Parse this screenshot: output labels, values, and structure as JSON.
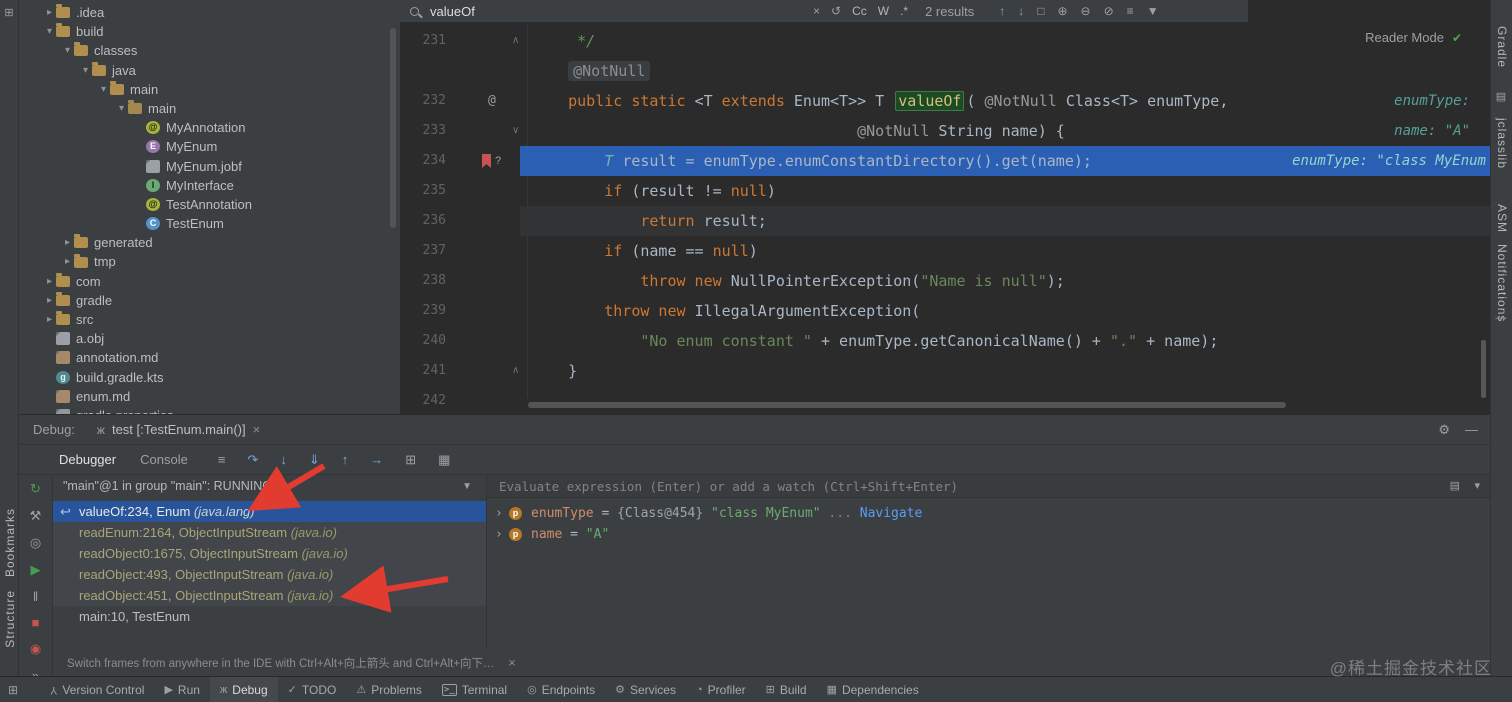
{
  "glyphs": {
    "tool_windows": "⊞",
    "gear": "⚙",
    "minimize": "—",
    "close": "×",
    "bug": "ж",
    "reader_check": "✔",
    "funnel": "▼",
    "db": "▤",
    "dash": "—",
    "return_arrow": "↩"
  },
  "find_bar": {
    "query": "valueOf",
    "match_case": "Cc",
    "words": "W",
    "regex": ".*",
    "results": "2 results",
    "left_icons": [
      {
        "name": "clear-search-icon",
        "glyph": "×"
      },
      {
        "name": "search-history-icon",
        "glyph": "↺"
      }
    ],
    "right_icons": [
      {
        "name": "prev-occurrence-icon",
        "glyph": "↑",
        "cls": "blue"
      },
      {
        "name": "next-occurrence-icon",
        "glyph": "↓",
        "cls": "blue"
      },
      {
        "name": "select-all-occurrences-icon",
        "glyph": "□"
      },
      {
        "name": "add-selection-icon",
        "glyph": "⊕"
      },
      {
        "name": "remove-selection-icon",
        "glyph": "⊖"
      },
      {
        "name": "exclude-selection-icon",
        "glyph": "⊘"
      },
      {
        "name": "filter-search-lines-icon",
        "glyph": "≡"
      },
      {
        "name": "search-filter-funnel-icon",
        "glyph": "▼"
      }
    ]
  },
  "project_tree": {
    "items": [
      {
        "label": ".idea",
        "depth": 1,
        "chevron": "right",
        "icon": "folder"
      },
      {
        "label": "build",
        "depth": 1,
        "chevron": "down",
        "icon": "folder"
      },
      {
        "label": "classes",
        "depth": 2,
        "chevron": "down",
        "icon": "folder"
      },
      {
        "label": "java",
        "depth": 3,
        "chevron": "down",
        "icon": "folder"
      },
      {
        "label": "main",
        "depth": 4,
        "chevron": "down",
        "icon": "folder"
      },
      {
        "label": "main",
        "depth": 5,
        "chevron": "down",
        "icon": "package"
      },
      {
        "label": "MyAnnotation",
        "depth": 6,
        "chevron": "none",
        "icon": "annotation"
      },
      {
        "label": "MyEnum",
        "depth": 6,
        "chevron": "none",
        "icon": "enum"
      },
      {
        "label": "MyEnum.jobf",
        "depth": 6,
        "chevron": "none",
        "icon": "file"
      },
      {
        "label": "MyInterface",
        "depth": 6,
        "chevron": "none",
        "icon": "interface"
      },
      {
        "label": "TestAnnotation",
        "depth": 6,
        "chevron": "none",
        "icon": "annotation"
      },
      {
        "label": "TestEnum",
        "depth": 6,
        "chevron": "none",
        "icon": "class"
      },
      {
        "label": "generated",
        "depth": 2,
        "chevron": "right",
        "icon": "folder"
      },
      {
        "label": "tmp",
        "depth": 2,
        "chevron": "right",
        "icon": "folder"
      },
      {
        "label": "com",
        "depth": 1,
        "chevron": "right",
        "icon": "folder"
      },
      {
        "label": "gradle",
        "depth": 1,
        "chevron": "right",
        "icon": "folder"
      },
      {
        "label": "src",
        "depth": 1,
        "chevron": "right",
        "icon": "folder"
      },
      {
        "label": "a.obj",
        "depth": 1,
        "chevron": "none",
        "icon": "file"
      },
      {
        "label": "annotation.md",
        "depth": 1,
        "chevron": "none",
        "icon": "markdown"
      },
      {
        "label": "build.gradle.kts",
        "depth": 1,
        "chevron": "none",
        "icon": "gradle"
      },
      {
        "label": "enum.md",
        "depth": 1,
        "chevron": "none",
        "icon": "markdown"
      },
      {
        "label": "gradle.properties",
        "depth": 1,
        "chevron": "none",
        "icon": "properties"
      }
    ]
  },
  "editor": {
    "reader_mode": "Reader Mode",
    "lines": [
      {
        "num": "231",
        "fold": "up",
        "tokens": [
          {
            "t": "     */",
            "c": "cm"
          }
        ]
      },
      {
        "num": "",
        "ann": true,
        "tokens": [
          {
            "t": "    ",
            "c": "d"
          },
          {
            "t": "@NotNull",
            "c": "chip"
          }
        ]
      },
      {
        "num": "232",
        "gutter_at": true,
        "tokens": [
          {
            "t": "    ",
            "c": "d"
          },
          {
            "t": "public static ",
            "c": "k"
          },
          {
            "t": "<T ",
            "c": "d"
          },
          {
            "t": "extends ",
            "c": "k"
          },
          {
            "t": "Enum<T>> T ",
            "c": "d"
          },
          {
            "t": "valueOf",
            "c": "match"
          },
          {
            "t": "( ",
            "c": "d"
          },
          {
            "t": "@NotNull ",
            "c": "ext"
          },
          {
            "t": "Class<T> enumType,",
            "c": "d"
          }
        ],
        "hint": "enumType:"
      },
      {
        "num": "233",
        "fold": "down",
        "tokens": [
          {
            "t": "                                    ",
            "c": "d"
          },
          {
            "t": "@NotNull ",
            "c": "ext"
          },
          {
            "t": "String name) {",
            "c": "d"
          }
        ],
        "hint": "name: \"A\""
      },
      {
        "num": "234",
        "exec": true,
        "tokens": [
          {
            "t": "        ",
            "c": "d"
          },
          {
            "t": "T ",
            "c": "tp"
          },
          {
            "t": "result = enumType.enumConstantDirectory().get(name);",
            "c": "d"
          }
        ],
        "hint": "enumType: \"class MyEnum"
      },
      {
        "num": "235",
        "tokens": [
          {
            "t": "        ",
            "c": "d"
          },
          {
            "t": "if ",
            "c": "k"
          },
          {
            "t": "(result != ",
            "c": "d"
          },
          {
            "t": "null",
            "c": "k"
          },
          {
            "t": ")",
            "c": "d"
          }
        ]
      },
      {
        "num": "236",
        "caret": true,
        "tokens": [
          {
            "t": "            ",
            "c": "d"
          },
          {
            "t": "return ",
            "c": "k"
          },
          {
            "t": "result;",
            "c": "d"
          }
        ]
      },
      {
        "num": "237",
        "tokens": [
          {
            "t": "        ",
            "c": "d"
          },
          {
            "t": "if ",
            "c": "k"
          },
          {
            "t": "(name == ",
            "c": "d"
          },
          {
            "t": "null",
            "c": "k"
          },
          {
            "t": ")",
            "c": "d"
          }
        ]
      },
      {
        "num": "238",
        "tokens": [
          {
            "t": "            ",
            "c": "d"
          },
          {
            "t": "throw new ",
            "c": "k"
          },
          {
            "t": "NullPointerException(",
            "c": "d"
          },
          {
            "t": "\"Name is null\"",
            "c": "s"
          },
          {
            "t": ");",
            "c": "d"
          }
        ]
      },
      {
        "num": "239",
        "tokens": [
          {
            "t": "        ",
            "c": "d"
          },
          {
            "t": "throw new ",
            "c": "k"
          },
          {
            "t": "IllegalArgumentException(",
            "c": "d"
          }
        ]
      },
      {
        "num": "240",
        "tokens": [
          {
            "t": "            ",
            "c": "d"
          },
          {
            "t": "\"No enum constant \"",
            "c": "s"
          },
          {
            "t": " + enumType.getCanonicalName() + ",
            "c": "d"
          },
          {
            "t": "\".\"",
            "c": "s"
          },
          {
            "t": " + name);",
            "c": "d"
          }
        ]
      },
      {
        "num": "241",
        "fold": "up",
        "tokens": [
          {
            "t": "    }",
            "c": "d"
          }
        ]
      },
      {
        "num": "242",
        "tokens": []
      }
    ]
  },
  "debug": {
    "label": "Debug:",
    "session_tab": "test [:TestEnum.main()]",
    "tabs": [
      "Debugger",
      "Console"
    ],
    "toolbar_icons": [
      {
        "name": "show-execution-point-icon",
        "glyph": "≡"
      },
      {
        "name": "step-over-icon",
        "glyph": "↷",
        "cls": "blue"
      },
      {
        "name": "step-into-icon",
        "glyph": "↓",
        "cls": "blue"
      },
      {
        "name": "force-step-into-icon",
        "glyph": "⇓",
        "cls": "blue"
      },
      {
        "name": "step-out-icon",
        "glyph": "↑",
        "cls": "blue"
      },
      {
        "name": "run-to-cursor-icon",
        "glyph": "→",
        "cls": "blue"
      },
      {
        "name": "view-layout-grid-icon",
        "glyph": "⊞"
      },
      {
        "name": "restore-layout-icon",
        "glyph": "▦"
      }
    ],
    "left_toolbar": [
      {
        "name": "rerun-debug-icon",
        "glyph": "↻",
        "cls": "green"
      },
      {
        "name": "build-hammer-icon",
        "glyph": "⚒"
      },
      {
        "name": "view-breakpoints-icon",
        "glyph": "◎"
      },
      {
        "name": "resume-icon",
        "glyph": "▶",
        "cls": "green"
      },
      {
        "name": "pause-icon",
        "glyph": "‖"
      },
      {
        "name": "stop-icon",
        "glyph": "■",
        "cls": "red"
      },
      {
        "name": "breakpoints-icon",
        "glyph": "◉",
        "cls": "red"
      },
      {
        "name": "more-icon",
        "glyph": "»"
      }
    ],
    "thread": "\"main\"@1 in group \"main\": RUNNING",
    "frames": [
      {
        "text": "valueOf:234, Enum ",
        "pkg": "(java.lang)",
        "selected": true,
        "library": false,
        "icon": true
      },
      {
        "text": "readEnum:2164, ObjectInputStream ",
        "pkg": "(java.io)",
        "library": true
      },
      {
        "text": "readObject0:1675, ObjectInputStream ",
        "pkg": "(java.io)",
        "library": true
      },
      {
        "text": "readObject:493, ObjectInputStream ",
        "pkg": "(java.io)",
        "library": true
      },
      {
        "text": "readObject:451, ObjectInputStream ",
        "pkg": "(java.io)",
        "library": true
      },
      {
        "text": "main:10, TestEnum",
        "pkg": "",
        "library": false
      }
    ],
    "evaluate_placeholder": "Evaluate expression (Enter) or add a watch (Ctrl+Shift+Enter)",
    "evaluate_icons": [
      {
        "name": "variables-layout-icon",
        "glyph": "▤"
      },
      {
        "name": "evaluate-history-chevron-icon",
        "glyph": "▾"
      }
    ],
    "variables": [
      {
        "name": "enumType",
        "eq": " = ",
        "ref": "{Class@454} ",
        "value": "\"class MyEnum\"",
        "suffix": " ... ",
        "link": "Navigate"
      },
      {
        "name": "name",
        "eq": " = ",
        "ref": "",
        "value": "\"A\"",
        "suffix": "",
        "link": ""
      }
    ],
    "hint": "Switch frames from anywhere in the IDE with Ctrl+Alt+向上箭头 and Ctrl+Alt+向下…"
  },
  "status_bar": {
    "items": [
      {
        "label": "Version Control",
        "icon": "vcs-icon",
        "glyph": "Y",
        "flip": true
      },
      {
        "label": "Run",
        "icon": "run-icon",
        "glyph": "▶"
      },
      {
        "label": "Debug",
        "icon": "debug-icon",
        "glyph": "ж",
        "active": true
      },
      {
        "label": "TODO",
        "icon": "todo-icon",
        "glyph": "✓"
      },
      {
        "label": "Problems",
        "icon": "problems-icon",
        "glyph": "⚠"
      },
      {
        "label": "Terminal",
        "icon": "terminal-icon",
        "glyph": ">_",
        "term": true
      },
      {
        "label": "Endpoints",
        "icon": "endpoints-icon",
        "glyph": "◎"
      },
      {
        "label": "Services",
        "icon": "services-icon",
        "glyph": "⚙"
      },
      {
        "label": "Profiler",
        "icon": "profiler-icon",
        "glyph": "◔"
      },
      {
        "label": "Build",
        "icon": "build-icon",
        "glyph": "⊞"
      },
      {
        "label": "Dependencies",
        "icon": "dependencies-icon",
        "glyph": "▦"
      }
    ]
  },
  "stripes": {
    "left_bottom": [
      "Bookmarks",
      "Structure"
    ],
    "right": [
      "Gradle",
      "jclasslib",
      "ASM",
      "Notifications"
    ]
  },
  "watermark": "@稀土掘金技术社区"
}
